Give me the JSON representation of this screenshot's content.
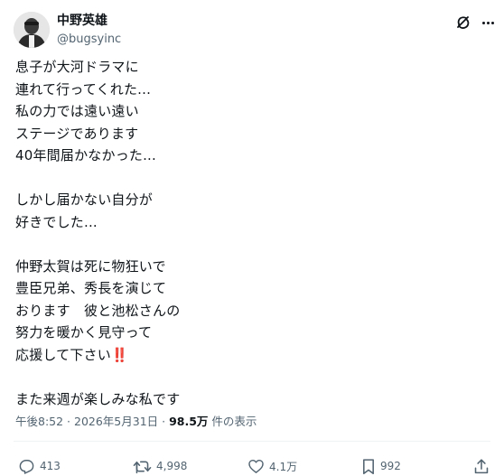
{
  "author": {
    "name": "中野英雄",
    "handle": "@bugsyinc"
  },
  "post": {
    "lines": [
      "息子が大河ドラマに",
      "連れて行ってくれた...",
      "私の力では遠い遠い",
      "ステージであります",
      "40年間届かなかった...",
      "",
      "しかし届かない自分が",
      "好きでした...",
      "",
      "仲野太賀は死に物狂いで",
      "豊臣兄弟、秀長を演じて",
      "おります　彼と池松さんの",
      "努力を暖かく見守って",
      "応援して下さい",
      "",
      "また来週が楽しみな私です"
    ],
    "emphasis_emoji": "‼️"
  },
  "meta": {
    "time": "午後8:52",
    "separator1": " · ",
    "date": "2026年5月31日",
    "separator2": " · ",
    "views_count": "98.5万",
    "views_label": " 件の表示"
  },
  "actions": {
    "replies": "413",
    "reposts": "4,998",
    "likes": "4.1万",
    "bookmarks": "992"
  },
  "icons": {
    "header": [
      "grok-icon",
      "more-icon"
    ],
    "actions": [
      "reply-icon",
      "repost-icon",
      "like-icon",
      "bookmark-icon",
      "share-icon"
    ]
  }
}
